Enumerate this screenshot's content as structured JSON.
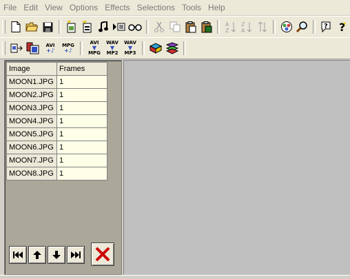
{
  "menu": [
    "File",
    "Edit",
    "View",
    "Options",
    "Effects",
    "Selections",
    "Tools",
    "Help"
  ],
  "toolbar2_text_buttons": [
    {
      "top": "AVI",
      "bottom": "+♪"
    },
    {
      "top": "MPG",
      "bottom": "+♪"
    },
    {
      "top": "AVI",
      "bottom": "MPG"
    },
    {
      "top": "WAV",
      "bottom": "MP2"
    },
    {
      "top": "WAV",
      "bottom": "MP3"
    }
  ],
  "grid": {
    "headers": {
      "image": "Image",
      "frames": "Frames"
    },
    "rows": [
      {
        "image": "MOON1.JPG",
        "frames": "1"
      },
      {
        "image": "MOON2.JPG",
        "frames": "1"
      },
      {
        "image": "MOON3.JPG",
        "frames": "1"
      },
      {
        "image": "MOON4.JPG",
        "frames": "1"
      },
      {
        "image": "MOON5.JPG",
        "frames": "1"
      },
      {
        "image": "MOON6.JPG",
        "frames": "1"
      },
      {
        "image": "MOON7.JPG",
        "frames": "1"
      },
      {
        "image": "MOON8.JPG",
        "frames": "1"
      }
    ]
  },
  "colors": {
    "delete_x": "#cc0000",
    "preview_bg": "#c0c0c0",
    "panel_bg": "#aca899"
  }
}
